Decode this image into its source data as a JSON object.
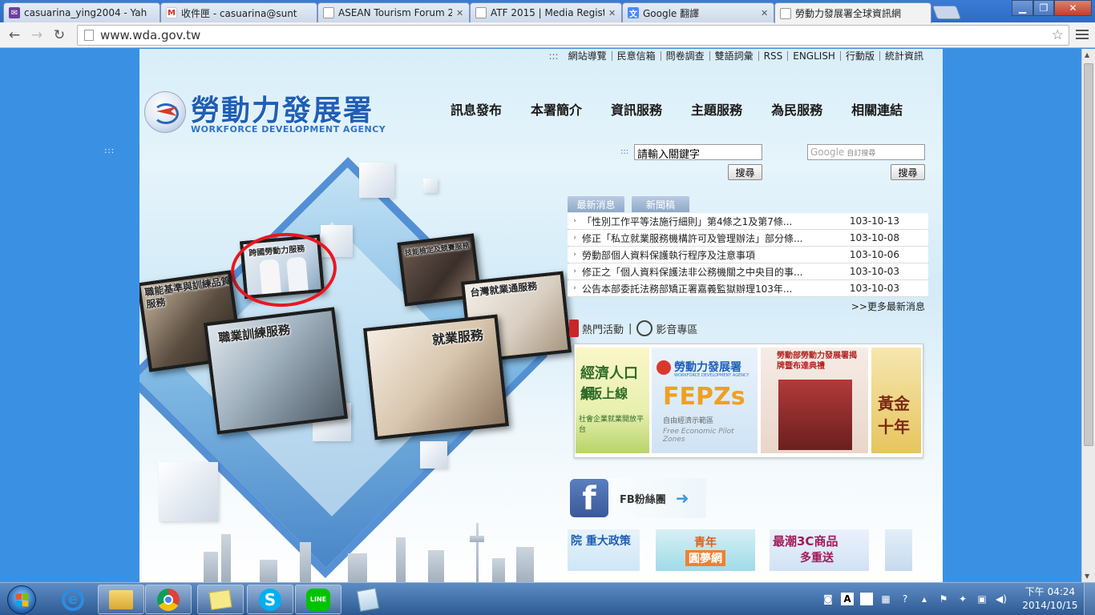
{
  "browser": {
    "tabs": [
      {
        "title": "casuarina_ying2004 - Yah",
        "favicon": "yahoo-mail-icon",
        "color": "#6b3fa0"
      },
      {
        "title": "收件匣 - casuarina@sunt",
        "favicon": "gmail-icon",
        "color": "#d93025"
      },
      {
        "title": "ASEAN Tourism Forum 2",
        "favicon": "page-icon",
        "color": "#ffffff"
      },
      {
        "title": "ATF 2015 | Media Regist",
        "favicon": "page-icon",
        "color": "#ffffff"
      },
      {
        "title": "Google 翻譯",
        "favicon": "google-translate-icon",
        "color": "#4a8af4"
      },
      {
        "title": "勞動力發展署全球資訊網",
        "favicon": "page-icon",
        "color": "#ffffff"
      }
    ],
    "url": "www.wda.gov.tw"
  },
  "site": {
    "utility_links": [
      "網站導覽",
      "民意信箱",
      "問卷調查",
      "雙語詞彙",
      "RSS",
      "ENGLISH",
      "行動版",
      "統計資訊"
    ],
    "logo_cn": "勞動力發展署",
    "logo_en": "WORKFORCE DEVELOPMENT AGENCY",
    "nav": [
      "訊息發布",
      "本署簡介",
      "資訊服務",
      "主題服務",
      "為民服務",
      "相關連結"
    ],
    "search": {
      "value": "請輸入關鍵字",
      "button": "搜尋"
    },
    "google_search": {
      "placeholder": "自訂搜尋",
      "brand": "Google",
      "button": "搜尋"
    },
    "hero_cards": [
      "跨國勞動力服務",
      "技能檢定及競賽服務",
      "職能基準與訓練品質服務",
      "台灣就業通服務",
      "職業訓練服務",
      "就業服務"
    ],
    "news_tabs": [
      "最新消息",
      "新聞稿"
    ],
    "news": [
      {
        "title": "「性別工作平等法施行細則」第4條之1及第7條...",
        "date": "103-10-13"
      },
      {
        "title": "修正「私立就業服務機構許可及管理辦法」部分條...",
        "date": "103-10-08"
      },
      {
        "title": "勞動部個人資料保護執行程序及注意事項",
        "date": "103-10-06"
      },
      {
        "title": "修正之「個人資料保護法非公務機關之中央目的事...",
        "date": "103-10-03"
      },
      {
        "title": "公告本部委託法務部矯正署嘉義監獄辦理103年...",
        "date": "103-10-03"
      }
    ],
    "more_news": ">>更多最新消息",
    "hot_activities": "熱門活動",
    "media_zone": "影音專區",
    "banners": {
      "b1_line1": "經濟人口網",
      "b1_line2": "1版上線",
      "b1_sub": "社會企業就業開放平台",
      "b2_title": "勞動力發展署",
      "b2_sub_en": "WORKFORCE DEVELOPMENT AGENCY",
      "b2_big": "FEPZs",
      "b2_cn": "自由經濟示範區",
      "b2_en": "Free Economic Pilot Zones",
      "b3_title": "勞動部勞動力發展署揭牌暨布達典禮",
      "b4": "黃金十年"
    },
    "fb_label": "FB粉絲團",
    "small_banners": {
      "sb1": "院 重大政策",
      "sb2_line1": "青年",
      "sb2_line2": "圓夢網",
      "sb3_line1": "最潮3C商品",
      "sb3_line2": "多重送"
    }
  },
  "taskbar": {
    "time": "下午 04:24",
    "date": "2014/10/15"
  }
}
